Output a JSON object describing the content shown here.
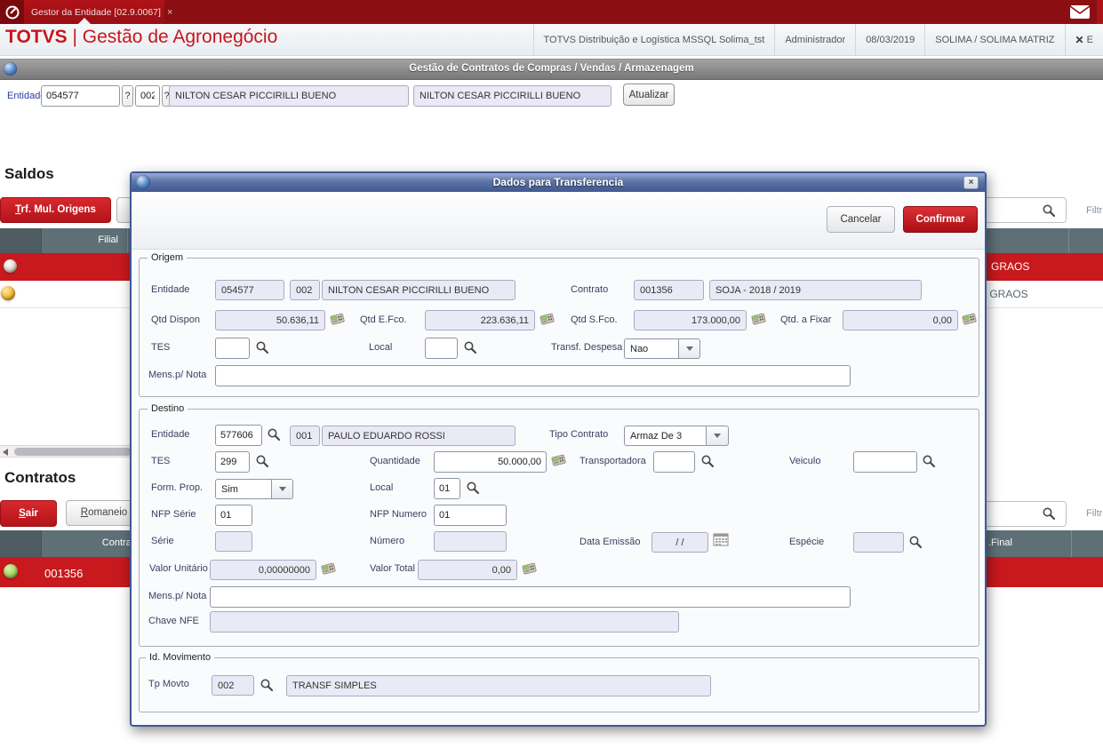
{
  "colors": {
    "brand_red": "#c8161c",
    "row_red": "#c8191e",
    "modal_titlebar_blue": "#42588f",
    "table_header": "#5e7076"
  },
  "topbar": {
    "tab_title": "Gestor da Entidade [02.9.0067]",
    "tab_close": "×"
  },
  "header": {
    "brand_name": "TOTVS",
    "brand_sep": "|",
    "brand_module": "Gestão de Agronegócio",
    "environment": "TOTVS Distribuição e Logística MSSQL Solima_tst",
    "user": "Administrador",
    "date": "08/03/2019",
    "branch": "SOLIMA / SOLIMA MATRIZ",
    "close_x": "✕",
    "close_partial": "E"
  },
  "toolbar": {
    "title": "Gestão de Contratos de Compras / Vendas / Armazenagem"
  },
  "entity_bar": {
    "label": "Entidade",
    "code": "054577",
    "help1": "?",
    "store": "002",
    "help2": "?",
    "name": "NILTON CESAR PICCIRILLI BUENO",
    "name_copy": "NILTON CESAR PICCIRILLI BUENO",
    "refresh_label": "Atualizar"
  },
  "saldos": {
    "title": "Saldos",
    "trf_mul_origens_label": "Trf. Mul. Origens",
    "search_value": "",
    "filter_label": "Filtrar",
    "columns": {
      "filial": "Filial"
    },
    "rows": [
      {
        "product_fragment": "GRAOS"
      },
      {
        "product_fragment": "M GRAOS"
      }
    ]
  },
  "contratos": {
    "title": "Contratos",
    "sair_label": "Sair",
    "romaneio_label": "Romaneio",
    "search_value": "",
    "filter_label": "Filtrar",
    "columns": {
      "contrato": "Contrato",
      "final_fragment": ".Final"
    },
    "rows": [
      {
        "contrato": "001356"
      }
    ]
  },
  "modal": {
    "title": "Dados para Transferencia",
    "close": "×",
    "buttons": {
      "cancel": "Cancelar",
      "confirm": "Confirmar"
    },
    "origem": {
      "legend": "Origem",
      "entidade_label": "Entidade",
      "entidade_code": "054577",
      "entidade_store": "002",
      "entidade_name": "NILTON CESAR PICCIRILLI BUENO",
      "contrato_label": "Contrato",
      "contrato_code": "001356",
      "contrato_desc": "SOJA  - 2018 / 2019",
      "qtd_dispon_label": "Qtd Dispon",
      "qtd_dispon": "50.636,11",
      "qtd_efco_label": "Qtd E.Fco.",
      "qtd_efco": "223.636,11",
      "qtd_sfco_label": "Qtd S.Fco.",
      "qtd_sfco": "173.000,00",
      "qtd_fixar_label": "Qtd. a Fixar",
      "qtd_fixar": "0,00",
      "tes_label": "TES",
      "tes": "",
      "local_label": "Local",
      "local": "",
      "transf_despesa_label": "Transf. Despesa",
      "transf_despesa": "Nao",
      "mens_label": "Mens.p/ Nota",
      "mens": ""
    },
    "destino": {
      "legend": "Destino",
      "entidade_label": "Entidade",
      "entidade_code": "577606",
      "entidade_store": "001",
      "entidade_name": "PAULO EDUARDO ROSSI",
      "tipo_contrato_label": "Tipo Contrato",
      "tipo_contrato": "Armaz De 3",
      "tes_label": "TES",
      "tes": "299",
      "quantidade_label": "Quantidade",
      "quantidade": "50.000,00",
      "transportadora_label": "Transportadora",
      "transportadora": "",
      "veiculo_label": "Veiculo",
      "veiculo": "",
      "form_prop_label": "Form. Prop.",
      "form_prop": "Sim",
      "local_label": "Local",
      "local": "01",
      "nfp_serie_label": "NFP Série",
      "nfp_serie": "01",
      "nfp_numero_label": "NFP Numero",
      "nfp_numero": "01",
      "serie_label": "Série",
      "serie": "",
      "numero_label": "Número",
      "numero": "",
      "data_emissao_label": "Data Emissão",
      "data_emissao": "/  /",
      "especie_label": "Espécie",
      "especie": "",
      "valor_unitario_label": "Valor Unitário",
      "valor_unitario": "0,00000000",
      "valor_total_label": "Valor Total",
      "valor_total": "0,00",
      "mens_label": "Mens.p/ Nota",
      "mens": "",
      "chave_nfe_label": "Chave NFE",
      "chave_nfe": ""
    },
    "movimento": {
      "legend": "Id. Movimento",
      "tp_movto_label": "Tp Movto",
      "tp_movto_code": "002",
      "tp_movto_desc": "TRANSF SIMPLES"
    }
  }
}
